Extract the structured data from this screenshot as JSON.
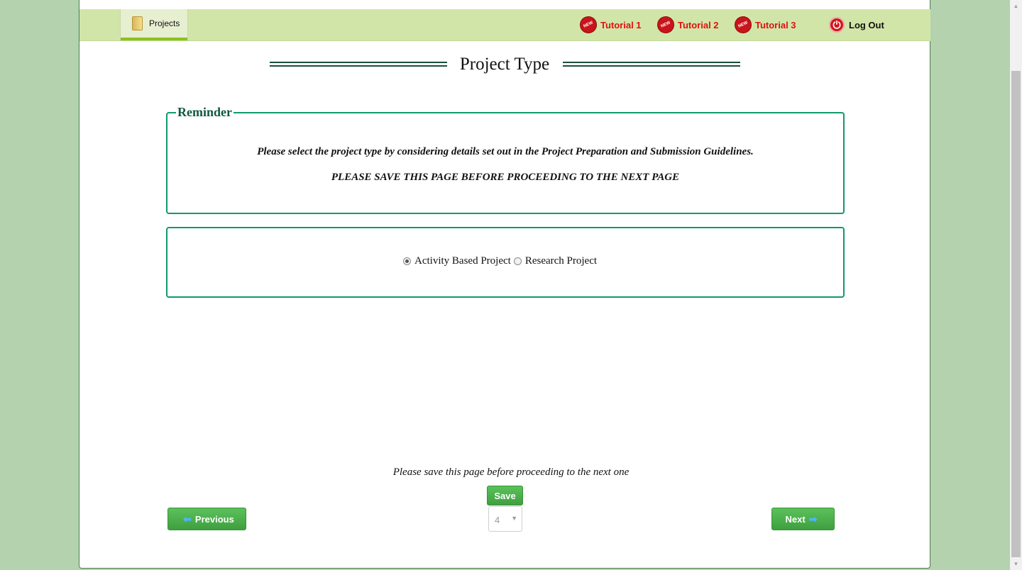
{
  "nav": {
    "tab_projects": "Projects",
    "tutorials": [
      "Tutorial 1",
      "Tutorial 2",
      "Tutorial 3"
    ],
    "new_badge": "NEW",
    "logout": "Log Out"
  },
  "page_title": "Project Type",
  "reminder": {
    "legend": "Reminder",
    "line1": "Please select the project type by considering details set out in the Project Preparation and Submission Guidelines.",
    "line2": "PLEASE SAVE THIS PAGE BEFORE PROCEEDING TO THE NEXT PAGE"
  },
  "project_type": {
    "options": [
      "Activity Based Project",
      "Research Project"
    ],
    "selected": "Activity Based Project"
  },
  "footer": {
    "save_note": "Please save this page before proceeding to the next one",
    "save_label": "Save",
    "previous_label": "Previous",
    "next_label": "Next",
    "page_select_value": "4"
  },
  "colors": {
    "accent_green": "#119a69",
    "button_green": "#4caf50",
    "tutorial_red": "#e01010",
    "navbar_bg": "#d2e5a8",
    "page_bg": "#b3d2ad"
  }
}
